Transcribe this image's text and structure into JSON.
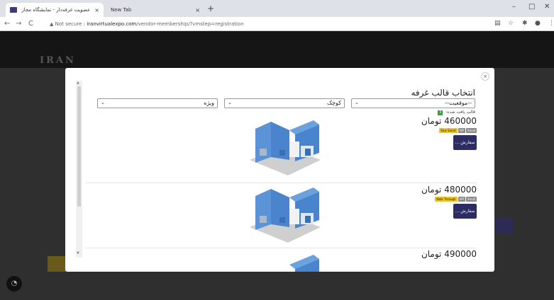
{
  "browser": {
    "tabs": [
      {
        "title": "عضویت غرفه‌دار - نمایشگاه مجازی...",
        "close": "×"
      },
      {
        "title": "New Tab",
        "close": "×"
      }
    ],
    "new_tab": "+",
    "controls": {
      "minimize": "–",
      "maximize": "□",
      "close": "✕"
    },
    "nav": {
      "back": "←",
      "forward": "→",
      "reload": "C"
    },
    "security": "▲ Not secure",
    "url_host": "iranvirtualexpo.com",
    "url_path": "/vendor-membership/?vmstep=registration",
    "toolbar_icons": [
      "translate-icon",
      "star-icon",
      "puzzle-icon",
      "profile-icon",
      "menu-icon"
    ]
  },
  "site": {
    "logo": "IRAN"
  },
  "modal": {
    "close": "×",
    "title": "انتخاب قالب غرفه",
    "filters": {
      "position": {
        "value": "--موقعیت--"
      },
      "size": {
        "value": "کوچک"
      },
      "type": {
        "value": "ویژه"
      }
    },
    "found_label": "قالب یافت شده:",
    "found_count": "3",
    "items": [
      {
        "price": "460000 تومان",
        "badges": [
          {
            "text": "Row Stand",
            "color": "#f0c419"
          },
          {
            "text": "VIP",
            "color": "#8a8a8a"
          },
          {
            "text": "Small",
            "color": "#8a8a8a"
          }
        ],
        "order": "سفارش ..."
      },
      {
        "price": "480000 تومان",
        "badges": [
          {
            "text": "Walk Through",
            "color": "#f0c419"
          },
          {
            "text": "VIP",
            "color": "#8a8a8a"
          },
          {
            "text": "Small",
            "color": "#8a8a8a"
          }
        ],
        "order": "سفارش ..."
      },
      {
        "price": "490000 تومان"
      }
    ]
  }
}
